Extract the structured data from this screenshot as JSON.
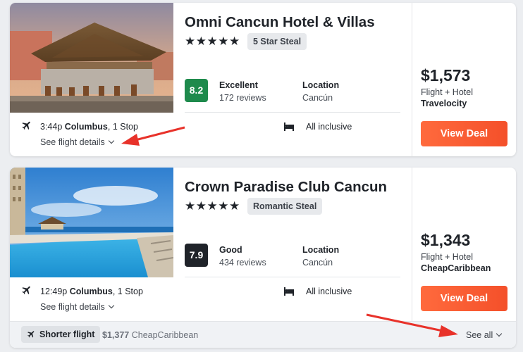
{
  "listings": [
    {
      "name": "Omni Cancun Hotel & Villas",
      "stars": "★★★★★",
      "badge": "5 Star Steal",
      "score": "8.2",
      "score_color": "#1e8a4c",
      "rating_label": "Excellent",
      "reviews": "172 reviews",
      "location_label": "Location",
      "location": "Cancún",
      "flight_time": "3:44p",
      "flight_city": "Columbus",
      "flight_stops": ", 1 Stop",
      "flight_details": "See flight details",
      "amenity": "All inclusive",
      "price": "$1,573",
      "price_type": "Flight + Hotel",
      "provider": "Travelocity",
      "cta": "View Deal"
    },
    {
      "name": "Crown Paradise Club Cancun",
      "stars": "★★★★★",
      "badge": "Romantic Steal",
      "score": "7.9",
      "score_color": "#1f2329",
      "rating_label": "Good",
      "reviews": "434 reviews",
      "location_label": "Location",
      "location": "Cancún",
      "flight_time": "12:49p",
      "flight_city": "Columbus",
      "flight_stops": ", 1 Stop",
      "flight_details": "See flight details",
      "amenity": "All inclusive",
      "price": "$1,343",
      "price_type": "Flight + Hotel",
      "provider": "CheapCaribbean",
      "cta": "View Deal"
    }
  ],
  "bottom_bar": {
    "pill": "Shorter flight",
    "alt_price": "$1,377",
    "alt_provider": "CheapCaribbean",
    "see_all": "See all"
  },
  "icons": {
    "plane": "airplane-icon",
    "bed": "bed-icon",
    "chevron": "chevron-down-icon"
  },
  "colors": {
    "cta": "#f4502a",
    "annotation_arrow": "#e8322a"
  }
}
